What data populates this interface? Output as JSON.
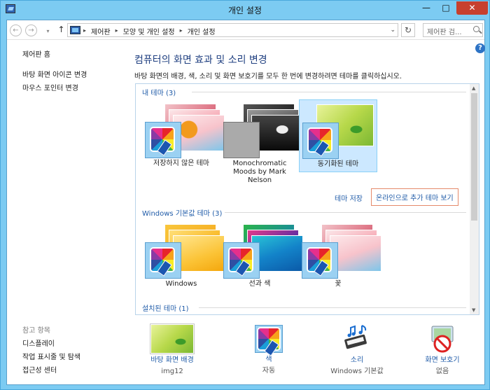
{
  "window": {
    "title": "개인 설정",
    "controls": {
      "minimize": "—",
      "maximize": "□",
      "close": "✕"
    }
  },
  "navbar": {
    "back": "←",
    "forward": "→",
    "recent": "▾",
    "up": "↑",
    "breadcrumb": [
      "제어판",
      "모양 및 개인 설정",
      "개인 설정"
    ],
    "breadcrumb_sep": "▸",
    "dropdown": "⌄",
    "refresh": "↻",
    "search_placeholder": "제어판 검..."
  },
  "help": "?",
  "sidebar": {
    "items": [
      "제어판 홈",
      "바탕 화면 아이콘 변경",
      "마우스 포인터 변경"
    ],
    "see_also_heading": "참고 항목",
    "see_also": [
      "디스플레이",
      "작업 표시줄 및 탐색",
      "접근성 센터"
    ]
  },
  "main": {
    "title": "컴퓨터의 화면 효과 및 소리 변경",
    "description": "바탕 화면의 배경, 색, 소리 및 화면 보호기를 모두 한 번에 변경하려면 테마를 클릭하십시오."
  },
  "groups": {
    "my_themes": "내 테마 (3)",
    "default_themes": "Windows 기본값 테마 (3)",
    "installed_themes": "설치된 테마 (1)"
  },
  "my_themes": [
    {
      "label": "저장하지 않은 테마"
    },
    {
      "label": "Monochromatic Moods by Mark Nelson"
    },
    {
      "label": "동기화된 테마"
    }
  ],
  "default_themes": [
    {
      "label": "Windows"
    },
    {
      "label": "선과 색"
    },
    {
      "label": "꽃"
    }
  ],
  "actions": {
    "save_theme": "테마 저장",
    "get_more_online": "온라인으로 추가 테마 보기"
  },
  "bottom": {
    "desktop_background": {
      "label": "바탕 화면 배경",
      "value": "img12"
    },
    "color": {
      "label": "색",
      "value": "자동"
    },
    "sounds": {
      "label": "소리",
      "value": "Windows 기본값"
    },
    "screen_saver": {
      "label": "화면 보호기",
      "value": "없음"
    }
  },
  "colors": {
    "window_frame": "#7ccbf2",
    "close_button": "#c7402e",
    "link": "#1f5ba8",
    "title": "#1f3f80",
    "selected_theme_bg": "#cce8ff",
    "highlight_border": "#e58a6a"
  }
}
